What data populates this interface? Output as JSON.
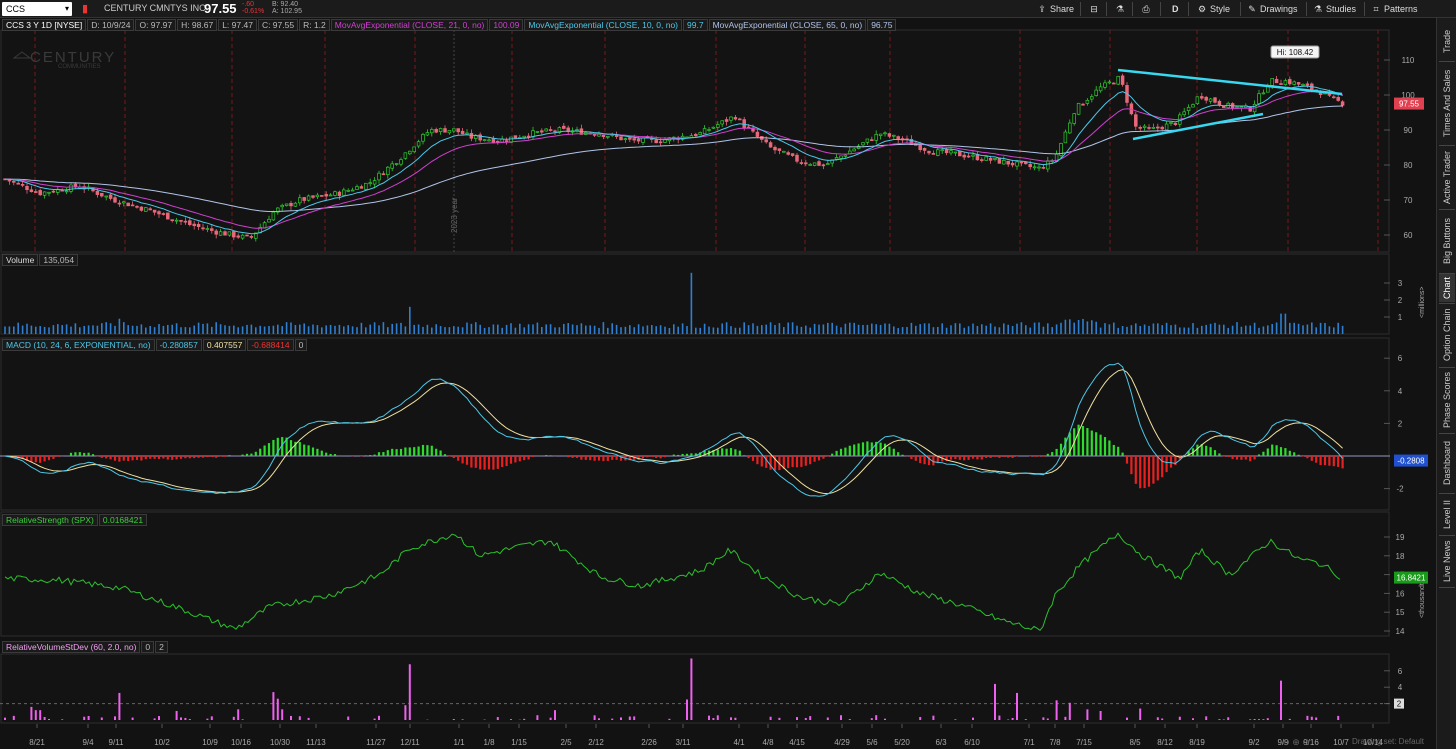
{
  "toolbar": {
    "symbol": "CCS",
    "company": "CENTURY CMNTYS INC",
    "last": "97.55",
    "change": "-.60",
    "change_pct": "-0.61%",
    "bid": "B: 92.40",
    "ask": "A: 102.95",
    "share": "Share",
    "aggregation": "D",
    "style": "Style",
    "drawings": "Drawings",
    "studies": "Studies",
    "patterns": "Patterns"
  },
  "header": {
    "title": "CCS 3 Y 1D [NYSE]",
    "date": "D: 10/9/24",
    "open": "O: 97.97",
    "high": "H: 98.67",
    "low": "L: 97.47",
    "close": "C: 97.55",
    "range": "R: 1.2",
    "ma1_label": "MovAvgExponential (CLOSE, 21, 0, no)",
    "ma1_value": "100.09",
    "ma2_label": "MovAvgExponential (CLOSE, 10, 0, no)",
    "ma2_value": "99.7",
    "ma3_label": "MovAvgExponential (CLOSE, 65, 0, no)",
    "ma3_value": "96.75",
    "watermark": "CENTURY",
    "watermark_sub": "COMMUNITIES"
  },
  "price_panel": {
    "yticks": [
      "110",
      "100",
      "90",
      "80",
      "70",
      "60"
    ],
    "hi_label": "Hi: 108.42",
    "current_tag": "97.55",
    "year_marker": "2023 year",
    "colors": {
      "up": "#2ecc2e",
      "down": "#e8687a",
      "ma21": "#d040d0",
      "ma10": "#4cc8e8",
      "ma65": "#b0c4e8",
      "trend": "#38d8f0"
    }
  },
  "volume_panel": {
    "label": "Volume",
    "value": "135,054",
    "yticks": [
      "3",
      "2",
      "1"
    ],
    "unit": "<millions>"
  },
  "macd_panel": {
    "label": "MACD (10, 24, 6, EXPONENTIAL, no)",
    "value": "-0.280857",
    "avg": "0.407557",
    "diff": "-0.688414",
    "zero": "0",
    "yticks": [
      "6",
      "4",
      "2",
      "-2"
    ],
    "current_tag": "-0.2808"
  },
  "rs_panel": {
    "label": "RelativeStrength (SPX)",
    "value": "0.0168421",
    "yticks": [
      "19",
      "18",
      "17",
      "16",
      "15",
      "14"
    ],
    "unit": "<thousandths>",
    "current_tag": "16.8421"
  },
  "rv_panel": {
    "label": "RelativeVolumeStDev (60, 2.0, no)",
    "value": "0",
    "threshold": "2",
    "yticks": [
      "6",
      "4",
      "2"
    ]
  },
  "xaxis": [
    "8/21",
    "9/4",
    "9/11",
    "10/2",
    "10/9",
    "10/16",
    "10/30",
    "11/13",
    "11/27",
    "12/11",
    "1/1",
    "1/8",
    "1/15",
    "2/5",
    "2/12",
    "2/26",
    "3/11",
    "4/1",
    "4/8",
    "4/15",
    "4/29",
    "5/6",
    "5/20",
    "6/3",
    "6/10",
    "7/1",
    "7/8",
    "7/15",
    "8/5",
    "8/12",
    "8/19",
    "9/2",
    "9/9",
    "9/16",
    "10/7",
    "10/14"
  ],
  "earnings_dates": [
    "10/2/23",
    "10/23/23",
    "11/1/23",
    "12/1/23",
    "1/10/24",
    "2/1/24",
    "3/1/24",
    "4/1/24",
    "5/1/24",
    "6/1/24",
    "7/1/24",
    "8/1/24",
    "9/1/24",
    "10/1/24"
  ],
  "footer_text": "Drawing set: Default",
  "sidebar": [
    "Trade",
    "Times And Sales",
    "Active Trader",
    "Big Buttons",
    "Chart",
    "Option Chain",
    "Phase Scores",
    "Dashboard",
    "Level II",
    "Live News"
  ]
}
